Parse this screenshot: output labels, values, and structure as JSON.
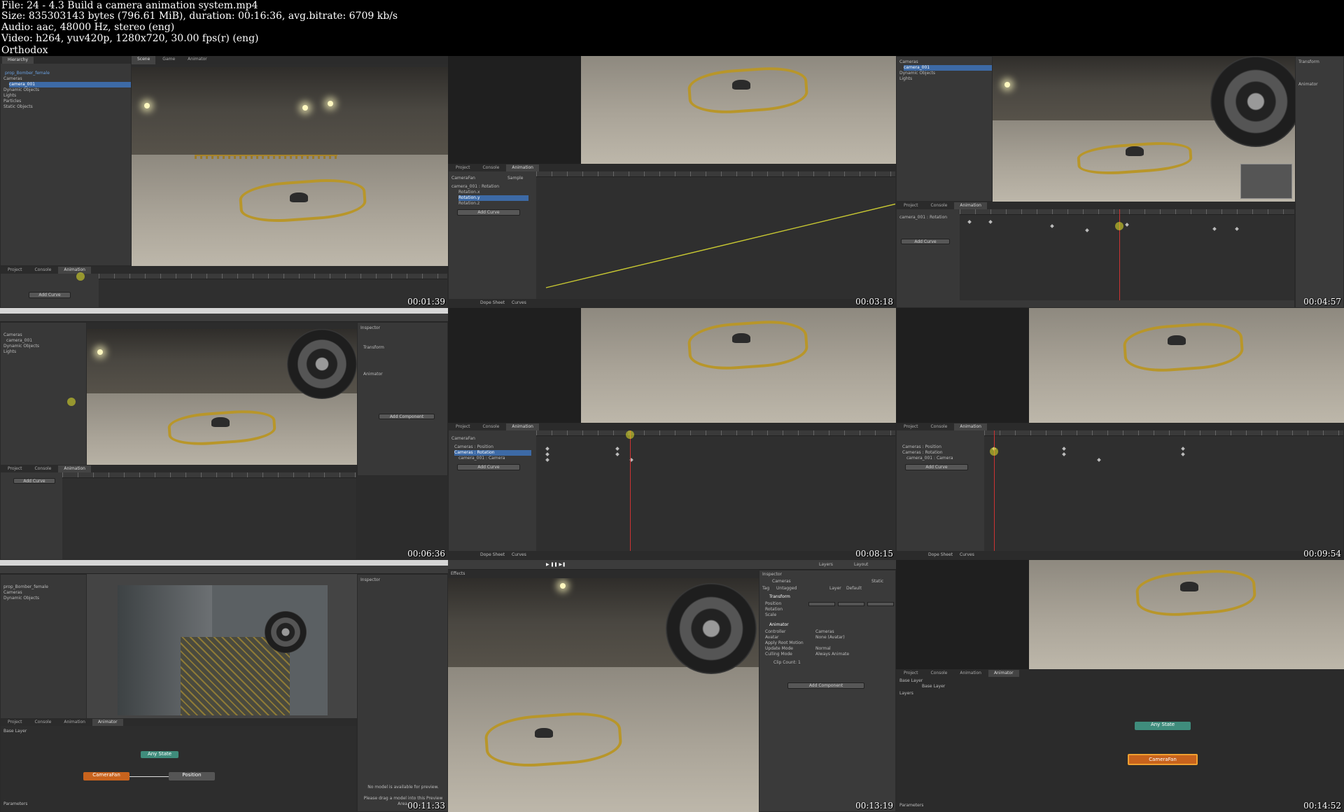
{
  "header": {
    "file": "File: 24 - 4.3 Build a camera animation system.mp4",
    "size": "Size: 835303143 bytes (796.61 MiB), duration: 00:16:36, avg.bitrate: 6709 kb/s",
    "audio": "Audio: aac, 48000 Hz, stereo (eng)",
    "video": "Video: h264, yuv420p, 1280x720, 30.00 fps(r) (eng)",
    "author": "Orthodox"
  },
  "thumbs": [
    {
      "timestamp": "00:01:39"
    },
    {
      "timestamp": "00:03:18"
    },
    {
      "timestamp": "00:04:57"
    },
    {
      "timestamp": "00:06:36"
    },
    {
      "timestamp": "00:08:15"
    },
    {
      "timestamp": "00:09:54"
    },
    {
      "timestamp": "00:11:33"
    },
    {
      "timestamp": "00:13:19"
    },
    {
      "timestamp": "00:14:52"
    }
  ],
  "unity": {
    "tab_project": "Project",
    "tab_console": "Console",
    "tab_animation": "Animation",
    "tab_animator": "Animator",
    "tab_scene": "Scene",
    "tab_game": "Game",
    "tab_inspector": "Inspector",
    "hierarchy_title": "Hierarchy",
    "hierarchy_items": [
      "prop_Bomber_female",
      "Cameras",
      "camera_001",
      "Dynamic Objects",
      "Lights",
      "Particles",
      "Static Objects"
    ],
    "add_curve": "Add Curve",
    "clip_name": "CameraFan",
    "sample": "Sample",
    "rot_track": "camera_001 : Rotation",
    "rot_x": "Rotation.x",
    "rot_y": "Rotation.y",
    "rot_z": "Rotation.z",
    "pos_track": "Cameras : Position",
    "cam_rot_track": "Cameras : Rotation",
    "cam_track": "camera_001 : Camera",
    "dope_sheet": "Dope Sheet",
    "curves": "Curves",
    "base_layer": "Base Layer",
    "layers": "Layers",
    "parameters": "Parameters",
    "any_state": "Any State",
    "camera_fan": "CameraFan",
    "effects": "Effects",
    "layers_dd": "Layers",
    "layout_dd": "Layout",
    "insp_name": "Cameras",
    "insp_static": "Static",
    "tag_label": "Tag",
    "tag_value": "Untagged",
    "layer_label": "Layer",
    "layer_value": "Default",
    "transform": "Transform",
    "position": "Position",
    "rotation": "Rotation",
    "scale": "Scale",
    "animator": "Animator",
    "controller": "Controller",
    "controller_value": "Cameras",
    "avatar": "Avatar",
    "avatar_value": "None (Avatar)",
    "apply_root": "Apply Root Motion",
    "update_mode": "Update Mode",
    "update_value": "Normal",
    "culling_mode": "Culling Mode",
    "culling_value": "Always Animate",
    "clip_info": "Clip Count: 1",
    "add_component": "Add Component",
    "no_model": "No model is available for preview.",
    "drag_model": "Please drag a model into this Preview Area."
  }
}
